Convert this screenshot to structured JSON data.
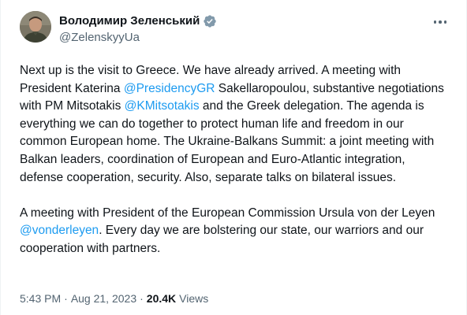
{
  "author": {
    "display_name": "Володимир Зеленський",
    "handle": "@ZelenskyyUa",
    "verified_icon": "verified-badge-icon",
    "avatar_icon": "avatar"
  },
  "more_menu_icon": "more-options-icon",
  "tweet": {
    "paragraph1": [
      {
        "text": "Next up is the visit to Greece. We have already arrived. A meeting with President Katerina ",
        "type": "text"
      },
      {
        "text": "@PresidencyGR",
        "type": "mention"
      },
      {
        "text": " Sakellaropoulou, substantive negotiations with PM Mitsotakis ",
        "type": "text"
      },
      {
        "text": "@KMitsotakis",
        "type": "mention"
      },
      {
        "text": " and the Greek delegation. The agenda is everything we can do together to protect human life and freedom in our common European home. The Ukraine-Balkans Summit: a joint meeting with Balkan leaders, coordination of European and Euro-Atlantic integration, defense cooperation, security. Also, separate talks on bilateral issues.",
        "type": "text"
      }
    ],
    "paragraph2": [
      {
        "text": "A meeting with President of the European Commission Ursula von der Leyen ",
        "type": "text"
      },
      {
        "text": "@vonderleyen",
        "type": "mention"
      },
      {
        "text": ". Every day we are bolstering our state, our warriors and our cooperation with partners.",
        "type": "text"
      }
    ]
  },
  "meta": {
    "time": "5:43 PM",
    "separator": "·",
    "date": "Aug 21, 2023",
    "views_count": "20.4K",
    "views_label": "Views"
  },
  "colors": {
    "link": "#1d9bf0",
    "secondary_text": "#536471",
    "primary_text": "#0f1419"
  }
}
